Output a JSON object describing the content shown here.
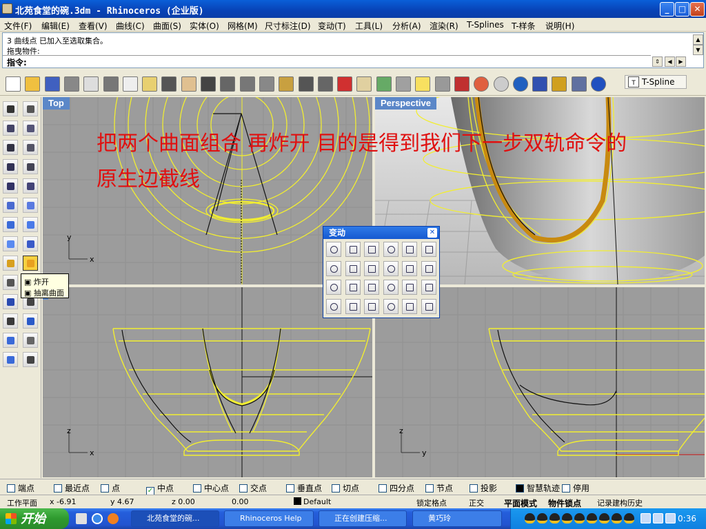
{
  "window": {
    "title": "北苑食堂的碗.3dm - Rhinoceros (企业版)",
    "min": "_",
    "max": "□",
    "close": "✕"
  },
  "menu": [
    "文件(F)",
    "编辑(E)",
    "查看(V)",
    "曲线(C)",
    "曲面(S)",
    "实体(O)",
    "网格(M)",
    "尺寸标注(D)",
    "变动(T)",
    "工具(L)",
    "分析(A)",
    "渲染(R)",
    "T-Splines",
    "T-样条",
    "说明(H)"
  ],
  "command": {
    "history": [
      "3 曲线点 已加入至选取集合。",
      "拖曳物件:"
    ],
    "prompt": "指令:"
  },
  "toolbar": {
    "tspline_label": "T-Spline",
    "icons": [
      "new-icon",
      "open-icon",
      "save-icon",
      "print-icon",
      "import-icon",
      "cut-icon",
      "copy-icon",
      "paste-icon",
      "undo-icon",
      "pan-icon",
      "rotate-view-icon",
      "zoom-icon",
      "zoom-window-icon",
      "zoom-extents-icon",
      "zoom-selected-icon",
      "undo-view-icon",
      "four-viewports-icon",
      "car-icon",
      "grid-icon",
      "cplane-icon",
      "osnap-icon",
      "light-icon",
      "lock-icon",
      "shade-icon",
      "color-wheel-icon",
      "wireframe-icon",
      "sphere-render-icon",
      "render-icon",
      "properties-icon",
      "options-icon",
      "help-icon"
    ]
  },
  "viewports": {
    "top": "Top",
    "perspective": "Perspective"
  },
  "overlay_text": {
    "line1": "把两个曲面组合 再炸开   目的是得到我们下一步双轨命令的",
    "line2": "原生边截线"
  },
  "axes": {
    "x": "x",
    "y": "y",
    "z": "z"
  },
  "tooltip": {
    "item1": "炸开",
    "item2": "抽离曲面"
  },
  "palette": {
    "title": "变动",
    "close": "✕"
  },
  "osnap": [
    {
      "label": "端点",
      "checked": false
    },
    {
      "label": "最近点",
      "checked": false
    },
    {
      "label": "点",
      "checked": false
    },
    {
      "label": "中点",
      "checked": true
    },
    {
      "label": "中心点",
      "checked": false
    },
    {
      "label": "交点",
      "checked": false
    },
    {
      "label": "垂直点",
      "checked": false
    },
    {
      "label": "切点",
      "checked": false
    },
    {
      "label": "四分点",
      "checked": false
    },
    {
      "label": "节点",
      "checked": false
    },
    {
      "label": "投影",
      "checked": false
    },
    {
      "label": "智慧轨迹",
      "checked": true
    },
    {
      "label": "停用",
      "checked": false
    }
  ],
  "status": {
    "cplane": "工作平面",
    "x": "x -6.91",
    "y": "y 4.67",
    "z": "z 0.00",
    "dist": "0.00",
    "layer": "Default",
    "grid_snap": "锁定格点",
    "ortho": "正交",
    "planar": "平面模式",
    "osnap": "物件锁点",
    "history": "记录建构历史"
  },
  "taskbar": {
    "start": "开始",
    "tasks": [
      "北苑食堂的碗...",
      "Rhinoceros Help",
      "正在创建压缩...",
      "黄巧玲"
    ],
    "clock": "0:36"
  }
}
